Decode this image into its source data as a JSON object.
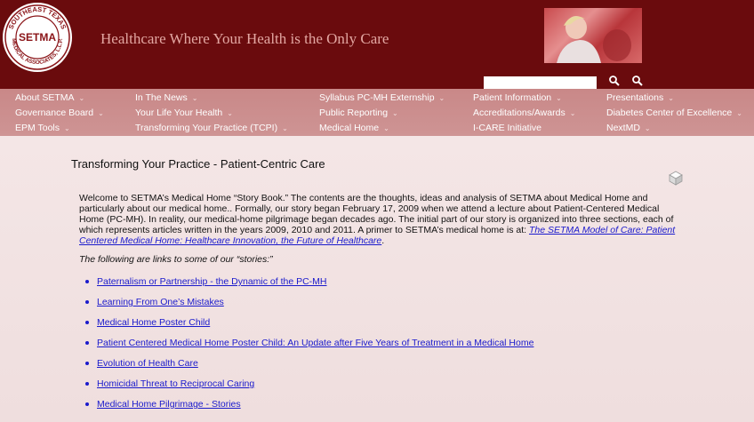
{
  "header": {
    "logo_arc_top": "SOUTHEAST TEXAS",
    "logo_center": "SETMA",
    "logo_arc_bottom": "MEDICAL ASSOCIATES, L.L.P.",
    "tagline": "Healthcare Where Your Health is the Only Care",
    "search": {
      "value": "",
      "placeholder": ""
    },
    "icons": [
      "search-icon",
      "advanced-search-icon"
    ]
  },
  "nav": {
    "items": [
      {
        "label": "About SETMA"
      },
      {
        "label": "Governance Board"
      },
      {
        "label": "EPM Tools"
      },
      {
        "label": "In The News"
      },
      {
        "label": "Your Life Your Health"
      },
      {
        "label": "Transforming Your Practice (TCPI)"
      },
      {
        "label": "Syllabus PC-MH Externship"
      },
      {
        "label": "Public Reporting"
      },
      {
        "label": "Medical Home"
      },
      {
        "label": "Patient Information"
      },
      {
        "label": "Accreditations/Awards"
      },
      {
        "label": "I-CARE Initiative"
      },
      {
        "label": "Presentations"
      },
      {
        "label": "Diabetes Center of Excellence"
      },
      {
        "label": "NextMD"
      }
    ],
    "chevron": "⌄"
  },
  "content": {
    "title": "Transforming Your Practice - Patient-Centric Care",
    "intro_text": "Welcome to SETMA’s Medical Home “Story Book.” The contents are the thoughts, ideas and analysis of SETMA about Medical Home and particularly about our medical home.. Formally, our story began February 17, 2009 when we attend a lecture about Patient-Centered Medical Home (PC-MH).  In reality, our medical-home pilgrimage began decades ago.  The initial part of our story is organized into three sections, each of which represents articles written in the years 2009, 2010 and 2011. A primer to SETMA’s medical home is at: ",
    "intro_link": "The SETMA Model of Care: Patient Centered Medical Home: Healthcare Innovation, the Future of Healthcare",
    "intro_end": ".",
    "following_text": "The following are links to some of our “stories:”",
    "stories": [
      "Paternalism or Partnership - the Dynamic of the PC-MH",
      "Learning From One’s Mistakes",
      "Medical Home Poster Child",
      "Patient Centered Medical Home Poster Child: An Update after Five Years of Treatment in a Medical Home",
      "Evolution of Health Care",
      "Homicidal Threat to Reciprocal Caring",
      "Medical Home Pilgrimage - Stories"
    ]
  },
  "colors": {
    "header_bg": "#6a0b0d",
    "nav_bg": "#c98888",
    "content_bg": "#f1e2e2",
    "link": "#1a1acc",
    "tagline": "#e3a7a2"
  }
}
